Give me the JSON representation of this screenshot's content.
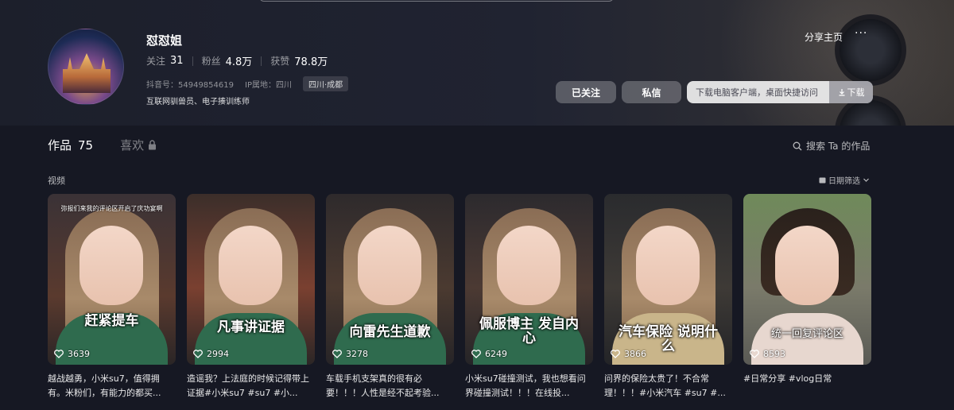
{
  "profile": {
    "name": "怼怼姐",
    "following_label": "关注",
    "following_count": "31",
    "followers_label": "粉丝",
    "followers_count": "4.8万",
    "likes_label": "获赞",
    "likes_count": "78.8万",
    "douyin_id": "抖音号：54949854619",
    "ip_location": "IP属地：四川",
    "region_tag": "四川·成都",
    "bio": "互联网驯兽员、电子揍训练师"
  },
  "actions": {
    "share": "分享主页",
    "more": "···",
    "followed": "已关注",
    "message": "私信",
    "download_hint": "下载电脑客户端，桌面快捷访问",
    "download": "下载"
  },
  "tabs": {
    "works_label": "作品",
    "works_count": "75",
    "likes_label": "喜欢"
  },
  "search_works": "搜索 Ta 的作品",
  "section_label": "视频",
  "date_filter": "日期筛选",
  "videos": [
    {
      "caption": "赶紧提车",
      "top_note": "弥报们来我的评论区开启了庆功宴啊",
      "likes": "3639",
      "desc": "越战越勇，小米su7，值得拥有。米粉们，有能力的都买..."
    },
    {
      "caption": "凡事讲证据",
      "top_note": "",
      "likes": "2994",
      "desc": "造谣我？上法庭的时候记得带上证据#小米su7 #su7 #小..."
    },
    {
      "caption": "向雷先生道歉",
      "top_note": "",
      "likes": "3278",
      "desc": "车载手机支架真的很有必要！！！人性是经不起考验..."
    },
    {
      "caption": "佩服博主 发自内心",
      "top_note": "",
      "likes": "6249",
      "desc": "小米su7碰撞测试，我也想看问界碰撞测试！！！在线投..."
    },
    {
      "caption": "汽车保险 说明什么",
      "top_note": "",
      "likes": "3866",
      "desc": "问界的保险太贵了！不合常理！！！#小米汽车 #su7 #..."
    },
    {
      "caption": "统一回复评论区",
      "top_note": "",
      "likes": "8593",
      "desc": "#日常分享 #vlog日常"
    }
  ],
  "colors": {
    "background": "#161823",
    "accent_button": "rgba(255,255,255,0.25)"
  }
}
